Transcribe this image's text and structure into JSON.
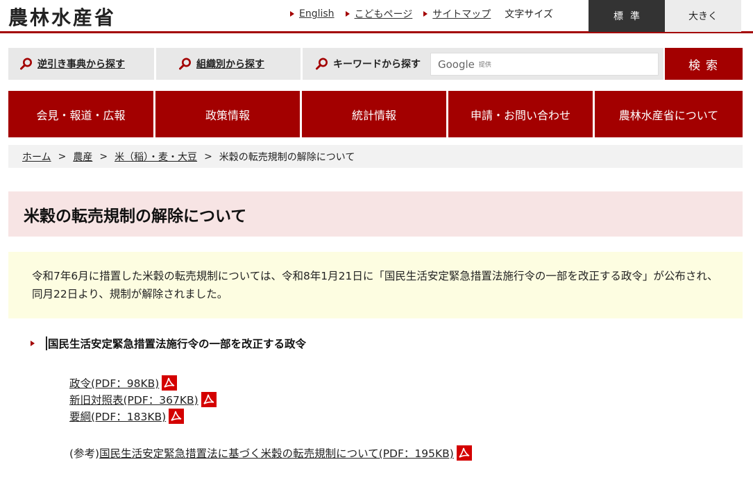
{
  "header": {
    "logo": "農林水産省",
    "links": [
      {
        "label": "English"
      },
      {
        "label": "こどもページ"
      },
      {
        "label": "サイトマップ"
      }
    ],
    "font_size_label": "文字サイズ",
    "font_standard": "標準",
    "font_large": "大きく"
  },
  "search": {
    "reverse_lookup": "逆引き事典から探す",
    "by_org": "組織別から探す",
    "by_keyword": "キーワードから探す",
    "google_logo": "Google",
    "google_suffix": "提供",
    "submit": "検索"
  },
  "nav": [
    {
      "label": "会見・報道・広報"
    },
    {
      "label": "政策情報"
    },
    {
      "label": "統計情報"
    },
    {
      "label": "申請・お問い合わせ"
    },
    {
      "label": "農林水産省について"
    }
  ],
  "breadcrumb": {
    "home": "ホーム",
    "agri": "農産",
    "rice": "米（稲）・麦・大豆",
    "current": "米穀の転売規制の解除について",
    "sep": ">"
  },
  "page_title": "米穀の転売規制の解除について",
  "notice": "令和7年6月に措置した米穀の転売規制については、令和8年1月21日に「国民生活安定緊急措置法施行令の一部を改正する政令」が公布され、同月22日より、規制が解除されました。",
  "section_heading": "国民生活安定緊急措置法施行令の一部を改正する政令",
  "documents": [
    {
      "label": "政令(PDF：98KB)"
    },
    {
      "label": "新旧対照表(PDF：367KB)"
    },
    {
      "label": "要綱(PDF：183KB)"
    }
  ],
  "reference": {
    "prefix": "(参考)",
    "label": "国民生活安定緊急措置法に基づく米穀の転売規制について(PDF：195KB)"
  },
  "colors": {
    "brand_red": "#a30000",
    "title_bg": "#f7e4e4",
    "notice_bg": "#fdfde1"
  },
  "icons": [
    "magnifier-icon",
    "pdf-icon",
    "triangle-bullet-icon"
  ]
}
